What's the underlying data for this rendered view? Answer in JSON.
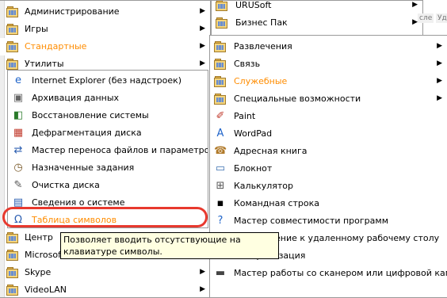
{
  "left_menu": [
    {
      "label": "Администрирование",
      "has_sub": true
    },
    {
      "label": "Игры",
      "has_sub": true
    },
    {
      "label": "Стандартные",
      "has_sub": true,
      "active": true
    },
    {
      "label": "Утилиты",
      "has_sub": true
    }
  ],
  "left_bottom": [
    {
      "label": "Центр"
    },
    {
      "label": "Microsoft"
    },
    {
      "label": "Skype",
      "has_sub": true
    },
    {
      "label": "VideoLAN",
      "has_sub": true
    }
  ],
  "utilities_menu": [
    {
      "label": "Internet Explorer (без надстроек)",
      "icon": "ie-icon"
    },
    {
      "label": "Архивация данных",
      "icon": "backup-icon"
    },
    {
      "label": "Восстановление системы",
      "icon": "system-restore-icon"
    },
    {
      "label": "Дефрагментация диска",
      "icon": "defrag-icon"
    },
    {
      "label": "Мастер переноса файлов и параметров",
      "icon": "transfer-wizard-icon"
    },
    {
      "label": "Назначенные задания",
      "icon": "scheduled-tasks-icon"
    },
    {
      "label": "Очистка диска",
      "icon": "disk-cleanup-icon"
    },
    {
      "label": "Сведения о системе",
      "icon": "system-info-icon"
    },
    {
      "label": "Таблица символов",
      "icon": "charmap-icon",
      "active": true
    }
  ],
  "right_top_menu": [
    {
      "label": "URUSoft",
      "has_sub": true
    },
    {
      "label": "Бизнес Пак",
      "has_sub": true
    }
  ],
  "accessories_menu": [
    {
      "label": "Развлечения",
      "has_sub": true,
      "icon": "folder-icon"
    },
    {
      "label": "Связь",
      "has_sub": true,
      "icon": "folder-icon"
    },
    {
      "label": "Служебные",
      "has_sub": true,
      "icon": "folder-icon",
      "active": true
    },
    {
      "label": "Специальные возможности",
      "has_sub": true,
      "icon": "folder-icon"
    },
    {
      "label": "Paint",
      "icon": "paint-icon"
    },
    {
      "label": "WordPad",
      "icon": "wordpad-icon"
    },
    {
      "label": "Адресная книга",
      "icon": "address-book-icon"
    },
    {
      "label": "Блокнот",
      "icon": "notepad-icon"
    },
    {
      "label": "Калькулятор",
      "icon": "calculator-icon"
    },
    {
      "label": "Командная строка",
      "icon": "cmd-icon"
    },
    {
      "label": "Мастер совместимости программ",
      "icon": "compat-wizard-icon"
    },
    {
      "label": "Подключение к удаленному рабочему столу",
      "icon": "rdp-icon"
    },
    {
      "label": "Синхронизация",
      "icon": "sync-icon"
    },
    {
      "label": "Мастер работы со сканером или цифровой камерой",
      "icon": "scanner-icon"
    }
  ],
  "tooltip": {
    "text": "Позволяет вводить отсутствующие на клавиатуре символы."
  },
  "background_fragments": [
    "сле",
    "Уд"
  ]
}
